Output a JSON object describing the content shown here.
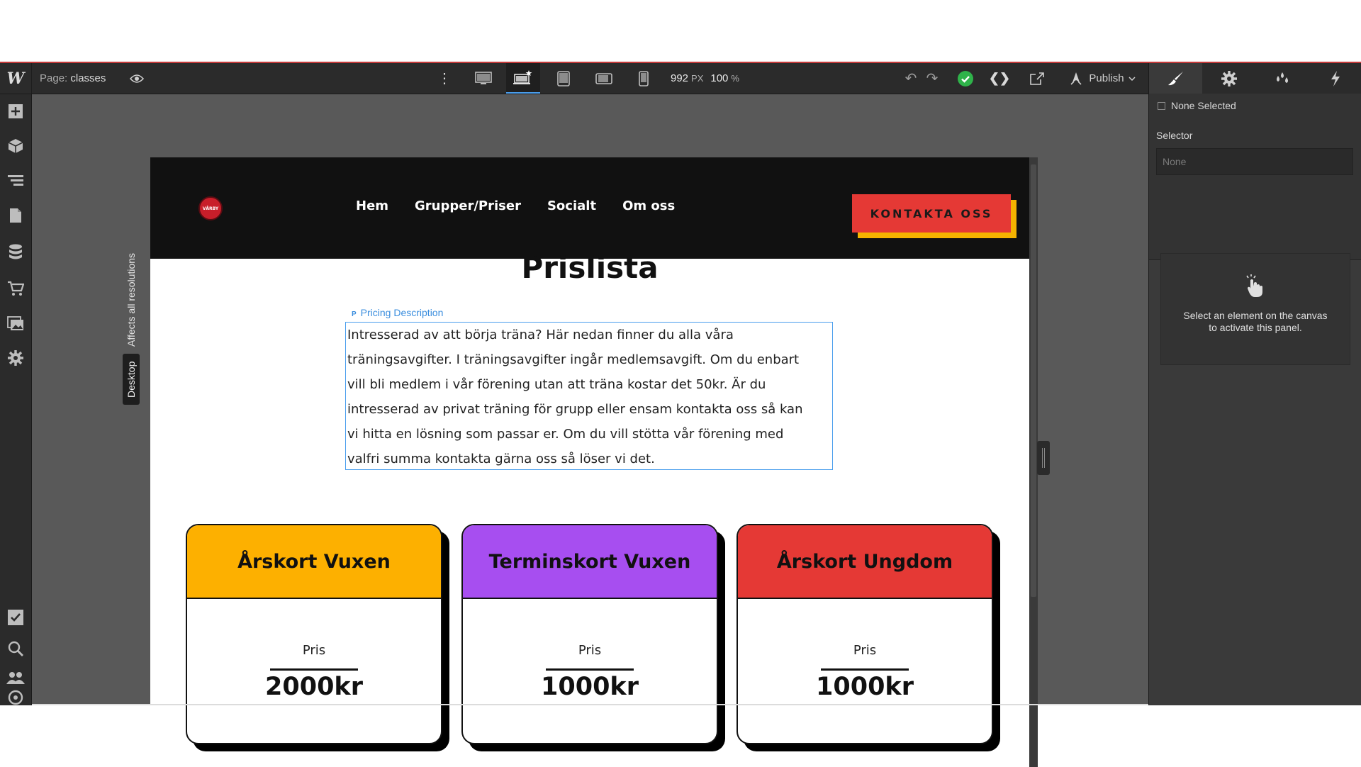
{
  "toolbar": {
    "logo": "W",
    "page_prefix": "Page:",
    "page_name": "classes",
    "kebab": "⋮",
    "width_value": "992",
    "width_unit": "PX",
    "zoom_value": "100",
    "zoom_unit": "%",
    "undo": "↶",
    "redo": "↷",
    "code": "❮❯",
    "publish_label": "Publish"
  },
  "left_panel": {
    "icons": [
      "add-icon",
      "cube-icon",
      "navigator-icon",
      "pages-icon",
      "cms-icon",
      "ecommerce-icon",
      "assets-icon",
      "settings-icon",
      "tasks-icon",
      "search-icon",
      "users-icon",
      "help-icon"
    ]
  },
  "breakpoint": {
    "affects": "Affects all resolutions",
    "label": "Desktop"
  },
  "right_panel": {
    "none_selected": "None Selected",
    "selector_label": "Selector",
    "selector_placeholder": "None",
    "hint_line1": "Select an element on the canvas",
    "hint_line2": "to activate this panel."
  },
  "site": {
    "logo_text": "VÅRBY",
    "nav": [
      "Hem",
      "Grupper/Priser",
      "Socialt",
      "Om oss"
    ],
    "cta": "KONTAKTA OSS",
    "title": "Prislista",
    "desc_tag": "Pricing Description",
    "desc_tag_icon": "P",
    "description_lines": [
      "Intresserad av att börja träna? Här nedan finner du alla våra",
      "träningsavgifter. I träningsavgifter ingår medlemsavgift. Om du enbart",
      "vill bli medlem i vår förening utan att träna kostar det 50kr. Är du",
      "intresserad av privat träning för grupp eller ensam kontakta oss så kan",
      "vi hitta en lösning som passar er. Om du vill stötta vår förening med",
      "valfri summa kontakta gärna oss så löser vi det."
    ],
    "cards": [
      {
        "title": "Årskort Vuxen",
        "pris": "Pris",
        "price": "2000kr",
        "color": "#fdb000"
      },
      {
        "title": "Terminskort Vuxen",
        "pris": "Pris",
        "price": "1000kr",
        "color": "#a74ef0"
      },
      {
        "title": "Årskort Ungdom",
        "pris": "Pris",
        "price": "1000kr",
        "color": "#e53935"
      }
    ]
  },
  "colors": {
    "status_ok": "#2fb34a",
    "selection": "#4a9eed",
    "cta_shadow": "#f5b300"
  }
}
